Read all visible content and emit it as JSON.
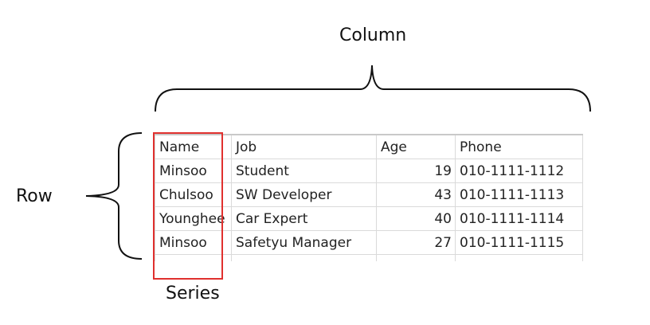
{
  "labels": {
    "column": "Column",
    "row": "Row",
    "series": "Series"
  },
  "table": {
    "headers": [
      "Name",
      "Job",
      "Age",
      "Phone"
    ],
    "rows": [
      [
        "Minsoo",
        "Student",
        "19",
        "010-1111-1112"
      ],
      [
        "Chulsoo",
        "SW Developer",
        "43",
        "010-1111-1113"
      ],
      [
        "Younghee",
        "Car Expert",
        "40",
        "010-1111-1114"
      ],
      [
        "Minsoo",
        "Safetyu Manager",
        "27",
        "010-1111-1115"
      ]
    ]
  },
  "colors": {
    "series_highlight": "#e0302e",
    "selected_column_edge": "#2e7d32",
    "gridline": "#dadada"
  }
}
